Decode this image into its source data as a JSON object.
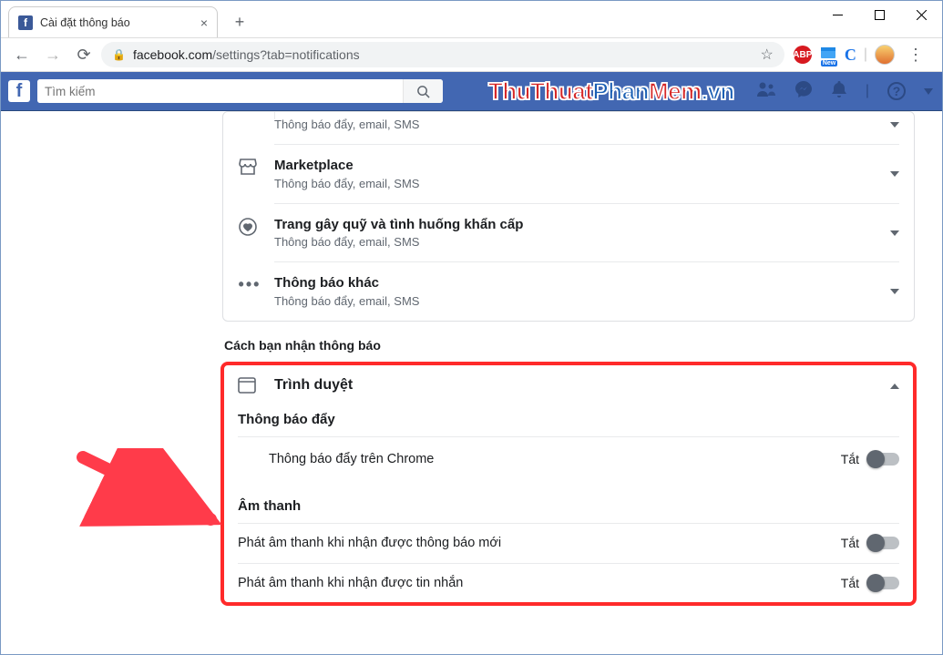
{
  "browser": {
    "tab_title": "Cài đặt thông báo",
    "url_domain": "facebook.com",
    "url_path": "/settings?tab=notifications"
  },
  "facebook": {
    "search_placeholder": "Tìm kiếm"
  },
  "watermark": {
    "p1": "ThuThuat",
    "p2": "Phan",
    "p3": "Mem",
    "p4": ".vn"
  },
  "rows": {
    "truncated_sub": "Thông báo đẩy, email, SMS",
    "marketplace": {
      "title": "Marketplace",
      "sub": "Thông báo đẩy, email, SMS"
    },
    "fundraiser": {
      "title": "Trang gây quỹ và tình huống khẩn cấp",
      "sub": "Thông báo đẩy, email, SMS"
    },
    "other": {
      "title": "Thông báo khác",
      "sub": "Thông báo đẩy, email, SMS"
    }
  },
  "section_label": "Cách bạn nhận thông báo",
  "browser_card": {
    "title": "Trình duyệt",
    "push_header": "Thông báo đẩy",
    "push_chrome": {
      "label": "Thông báo đẩy trên Chrome",
      "state": "Tắt"
    },
    "sound_header": "Âm thanh",
    "sound_new": {
      "label": "Phát âm thanh khi nhận được thông báo mới",
      "state": "Tắt"
    },
    "sound_msg": {
      "label": "Phát âm thanh khi nhận được tin nhắn",
      "state": "Tắt"
    }
  },
  "ext_new_badge": "New"
}
